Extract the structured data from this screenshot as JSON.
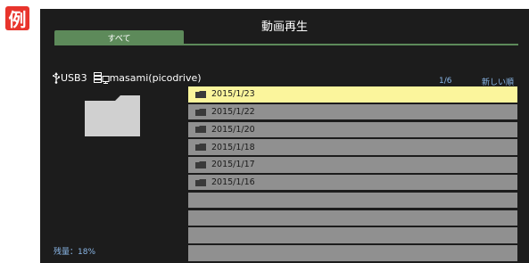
{
  "badge": {
    "label": "例"
  },
  "header": {
    "title": "動画再生"
  },
  "tabs": [
    {
      "label": "すべて",
      "active": true
    }
  ],
  "device": {
    "icon": "usb-icon",
    "name": "USB3",
    "server_icon": "media-server-icon",
    "server": "masami(picodrive)"
  },
  "pagination": {
    "indicator": "1/6"
  },
  "sort": {
    "label": "新しい順"
  },
  "storage": {
    "remaining": "残量：18%"
  },
  "folders": [
    {
      "name": "2015/1/23",
      "selected": true
    },
    {
      "name": "2015/1/22",
      "selected": false
    },
    {
      "name": "2015/1/20",
      "selected": false
    },
    {
      "name": "2015/1/18",
      "selected": false
    },
    {
      "name": "2015/1/17",
      "selected": false
    },
    {
      "name": "2015/1/16",
      "selected": false
    },
    {
      "name": "",
      "selected": false
    },
    {
      "name": "",
      "selected": false
    },
    {
      "name": "",
      "selected": false
    },
    {
      "name": "",
      "selected": false
    }
  ],
  "colors": {
    "accent_green": "#5d8a5a",
    "selection": "#fbf59c",
    "row_gray": "#909090",
    "info_blue": "#8ab7e8",
    "badge_red": "#e8342c"
  }
}
